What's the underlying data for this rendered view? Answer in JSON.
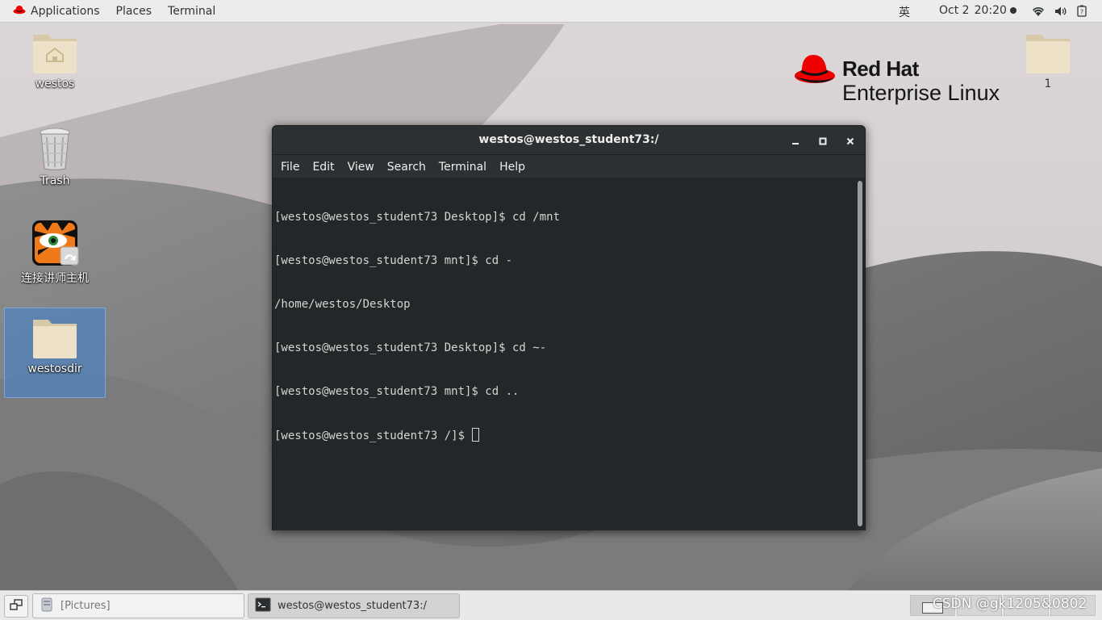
{
  "topbar": {
    "applications": "Applications",
    "places": "Places",
    "terminal": "Terminal",
    "ime": "英",
    "date": "Oct 2",
    "time": "20:20",
    "icons": [
      "wifi-icon",
      "volume-icon",
      "power-icon"
    ]
  },
  "desktop": {
    "icons": [
      {
        "label": "westos",
        "icon": "home-folder-icon"
      },
      {
        "label": "Trash",
        "icon": "trash-icon"
      },
      {
        "label": "连接讲师主机",
        "icon": "tiger-app-icon"
      },
      {
        "label": "westosdir",
        "icon": "folder-icon",
        "selected": true
      },
      {
        "label": "1",
        "icon": "folder-icon"
      }
    ]
  },
  "logo": {
    "line1": "Red Hat",
    "line2": "Enterprise Linux",
    "color": "#ee0000"
  },
  "terminal": {
    "title": "westos@westos_student73:/",
    "menu": [
      "File",
      "Edit",
      "View",
      "Search",
      "Terminal",
      "Help"
    ],
    "lines": [
      "[westos@westos_student73 Desktop]$ cd /mnt",
      "[westos@westos_student73 mnt]$ cd -",
      "/home/westos/Desktop",
      "[westos@westos_student73 Desktop]$ cd ~-",
      "[westos@westos_student73 mnt]$ cd ..",
      "[westos@westos_student73 /]$ "
    ]
  },
  "taskbar": {
    "tasks": [
      {
        "label": "[Pictures]",
        "icon": "file-manager-icon",
        "active": false
      },
      {
        "label": "westos@westos_student73:/",
        "icon": "terminal-icon",
        "active": true
      }
    ],
    "watermark": "CSDN @gk1205&0802"
  }
}
